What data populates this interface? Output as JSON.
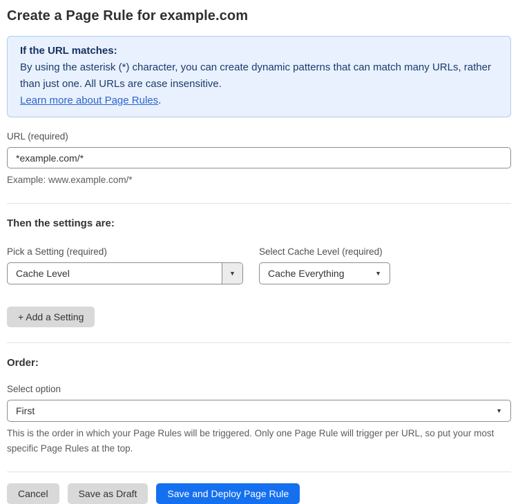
{
  "page": {
    "title": "Create a Page Rule for example.com"
  },
  "info_box": {
    "heading": "If the URL matches:",
    "body": "By using the asterisk (*) character, you can create dynamic patterns that can match many URLs, rather than just one. All URLs are case insensitive.",
    "link_label": "Learn more about Page Rules",
    "link_suffix": "."
  },
  "url_field": {
    "label": "URL (required)",
    "value": "*example.com/*",
    "helper": "Example: www.example.com/*"
  },
  "settings": {
    "heading": "Then the settings are:",
    "setting_label": "Pick a Setting (required)",
    "setting_value": "Cache Level",
    "cache_label": "Select Cache Level (required)",
    "cache_value": "Cache Everything",
    "add_button_label": "+ Add a Setting"
  },
  "order": {
    "heading": "Order:",
    "label": "Select option",
    "value": "First",
    "helper": "This is the order in which your Page Rules will be triggered. Only one Page Rule will trigger per URL, so put your most specific Page Rules at the top."
  },
  "actions": {
    "cancel_label": "Cancel",
    "save_draft_label": "Save as Draft",
    "save_deploy_label": "Save and Deploy Page Rule"
  },
  "icons": {
    "dropdown_arrow": "▼"
  },
  "colors": {
    "primary_blue": "#1570ef",
    "info_background": "#e8f1fd",
    "info_border": "#b0ccf3",
    "info_text": "#1d3a6d",
    "link_blue": "#2e64cf",
    "gray_button": "#d9d9d9"
  }
}
